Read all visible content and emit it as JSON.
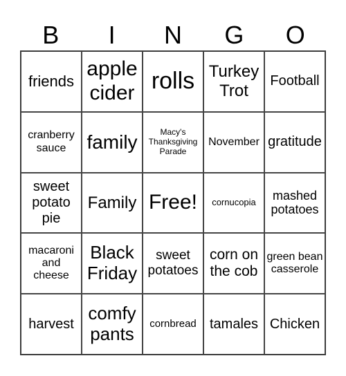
{
  "header": [
    "B",
    "I",
    "N",
    "G",
    "O"
  ],
  "cells": [
    "friends",
    "apple cider",
    "rolls",
    "Turkey Trot",
    "Football",
    "cranberry sauce",
    "family",
    "Macy's Thanksgiving Parade",
    "November",
    "gratitude",
    "sweet potato pie",
    "Family",
    "Free!",
    "cornucopia",
    "mashed potatoes",
    "macaroni and cheese",
    "Black Friday",
    "sweet potatoes",
    "corn on the cob",
    "green bean casserole",
    "harvest",
    "comfy pants",
    "cornbread",
    "tamales",
    "Chicken"
  ]
}
